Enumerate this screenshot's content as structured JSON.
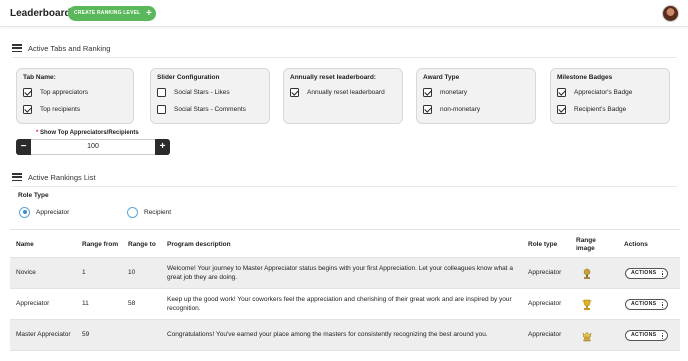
{
  "header": {
    "title": "Leaderboard",
    "create_button": "CREATE RANKING LEVEL",
    "create_plus": "+"
  },
  "active_tabs": {
    "heading": "Active Tabs and Ranking",
    "boxes": [
      {
        "title": "Tab Name:",
        "options": [
          {
            "label": "Top appreciators",
            "checked": true
          },
          {
            "label": "Top recipients",
            "checked": true
          }
        ]
      },
      {
        "title": "Slider Configuration",
        "options": [
          {
            "label": "Social Stars - Likes",
            "checked": false
          },
          {
            "label": "Social Stars - Comments",
            "checked": false
          }
        ]
      },
      {
        "title": "Annually reset leaderboard:",
        "options": [
          {
            "label": "Annually reset leaderboard",
            "checked": true
          }
        ]
      },
      {
        "title": "Award Type",
        "options": [
          {
            "label": "monetary",
            "checked": true
          },
          {
            "label": "non-monetary",
            "checked": true
          }
        ]
      },
      {
        "title": "Milestone Badges",
        "options": [
          {
            "label": "Appreciator's Badge",
            "checked": true
          },
          {
            "label": "Recipient's Badge",
            "checked": true
          }
        ]
      }
    ],
    "show_top": {
      "required_mark": "*",
      "label": "Show Top Appreciators/Recipients",
      "value": "100",
      "minus": "−",
      "plus": "+"
    }
  },
  "rankings": {
    "heading": "Active Rankings List",
    "role_type_label": "Role Type",
    "role_options": [
      {
        "label": "Appreciator",
        "selected": true
      },
      {
        "label": "Recipient",
        "selected": false
      }
    ],
    "columns": {
      "name": "Name",
      "range_from": "Range from",
      "range_to": "Range to",
      "description": "Program description",
      "role_type": "Role type",
      "range_image": "Range image",
      "actions": "Actions"
    },
    "rows": [
      {
        "name": "Novice",
        "from": "1",
        "to": "10",
        "description": "Welcome! Your journey to Master Appreciator status begins with your first Appreciation. Let your colleagues know what a great job they are doing.",
        "role": "Appreciator",
        "image": "bronze-trophy-icon",
        "actions": "ACTIONS"
      },
      {
        "name": "Appreciator",
        "from": "11",
        "to": "58",
        "description": "Keep up the good work! Your coworkers feel the appreciation and cherishing of their great work and are inspired by your recognition.",
        "role": "Appreciator",
        "image": "gold-trophy-icon",
        "actions": "ACTIONS"
      },
      {
        "name": "Master Appreciator",
        "from": "59",
        "to": "",
        "description": "Congratulations! You've earned your place among the masters for consistently recognizing the best around you.",
        "role": "Appreciator",
        "image": "crown-trophy-icon",
        "actions": "ACTIONS"
      }
    ]
  },
  "colors": {
    "accent_green": "#59b859",
    "radio_blue": "#3c8fce",
    "dark": "#2b2b2b"
  }
}
